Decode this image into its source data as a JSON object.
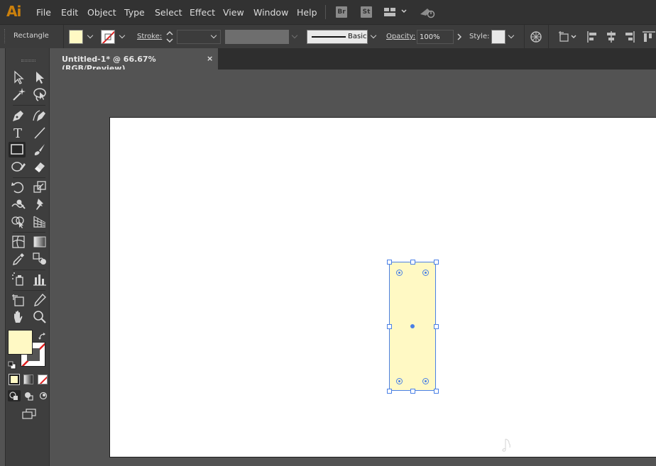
{
  "app": {
    "logo": "Ai"
  },
  "menu": {
    "items": [
      "File",
      "Edit",
      "Object",
      "Type",
      "Select",
      "Effect",
      "View",
      "Window",
      "Help"
    ],
    "bridge_label": "Br",
    "stock_label": "St"
  },
  "control_bar": {
    "selection_type": "Rectangle",
    "stroke_label": "Stroke:",
    "stroke_weight": "",
    "brush_label": "Basic",
    "opacity_label": "Opacity:",
    "opacity_value": "100%",
    "style_label": "Style:"
  },
  "document": {
    "tab_title": "Untitled-1* @ 66.67% (RGB/Preview)",
    "close_glyph": "×"
  },
  "colors": {
    "fill": "#fff9c4",
    "selection": "#4a80e6",
    "none_stroke_slash": "#e02020"
  },
  "tools": [
    "direct-selection-tool",
    "selection-tool",
    "magic-wand-tool",
    "lasso-tool",
    "pen-tool",
    "curvature-tool",
    "type-tool",
    "line-segment-tool",
    "rectangle-tool",
    "paintbrush-tool",
    "shaper-tool",
    "eraser-tool",
    "rotate-tool",
    "scale-tool",
    "warp-tool",
    "puppet-warp-tool",
    "shape-builder-tool",
    "perspective-grid-tool",
    "mesh-tool",
    "gradient-tool",
    "eyedropper-tool",
    "blend-tool",
    "symbol-sprayer-tool",
    "column-graph-tool",
    "artboard-tool",
    "slice-tool",
    "hand-tool",
    "zoom-tool"
  ],
  "active_tool": "rectangle-tool"
}
